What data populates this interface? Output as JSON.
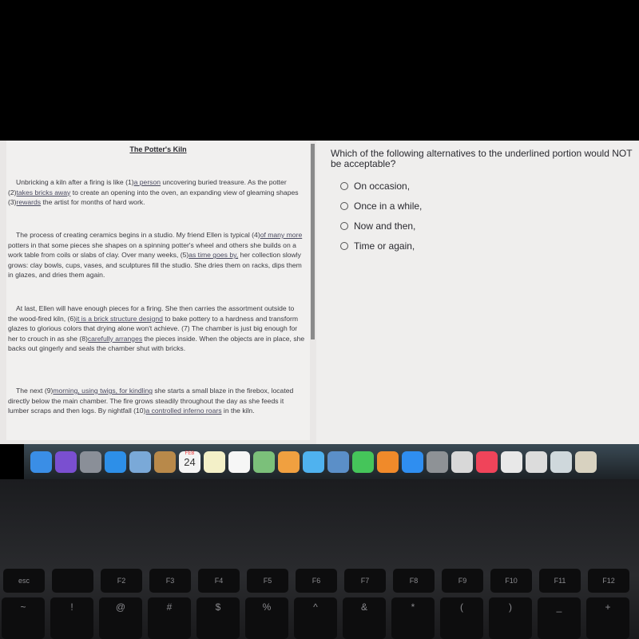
{
  "passage": {
    "title": "The Potter's Kiln",
    "paragraphs": [
      [
        {
          "t": "Unbricking a kiln after a firing is like (1)"
        },
        {
          "t": "a person",
          "u": true
        },
        {
          "t": " uncovering buried treasure. As the potter (2)"
        },
        {
          "t": "takes bricks away",
          "u": true
        },
        {
          "t": " to create an opening into the oven, an expanding view of gleaming shapes (3)"
        },
        {
          "t": "rewards",
          "u": true
        },
        {
          "t": " the artist for months of hard work."
        }
      ],
      [
        {
          "t": "The process of creating ceramics begins in a studio. My friend Ellen is typical (4)"
        },
        {
          "t": "of many more",
          "u": true
        },
        {
          "t": " potters in that some pieces she shapes on a spinning potter's wheel and others she builds on a work table from coils or slabs of clay. Over many weeks, (5)"
        },
        {
          "t": "as time goes by,",
          "u": true
        },
        {
          "t": " her collection slowly grows: clay bowls, cups, vases, and sculptures fill the studio. She dries them on racks, dips them in glazes, and dries them again."
        }
      ],
      [
        {
          "t": "At last, Ellen will have enough pieces for a firing. She then carries the assortment outside to the wood-fired kiln, (6)"
        },
        {
          "t": "it is a brick structure designd",
          "u": true
        },
        {
          "t": " to bake pottery to a hardness and transform glazes to glorious colors that drying alone won't achieve. (7) The chamber is just big enough for her to crouch in as she (8)"
        },
        {
          "t": "carefully arranges",
          "u": true
        },
        {
          "t": " the pieces inside. When the objects are in place, she backs out gingerly and seals the chamber shut with bricks."
        }
      ],
      [
        {
          "t": "The next (9)"
        },
        {
          "t": "morning, using twigs, for kindling",
          "u": true
        },
        {
          "t": " she starts a small blaze in the firebox, located directly below the main chamber. The fire grows steadily throughout the day as she feeds it lumber scraps and then logs. By nightfall (10)"
        },
        {
          "t": "a controlled inferno roars",
          "u": true
        },
        {
          "t": " in the kiln."
        }
      ]
    ]
  },
  "question": {
    "text": "Which of the following alternatives to the underlined portion would NOT be acceptable?",
    "options": [
      "On occasion,",
      "Once in a while,",
      "Now and then,",
      "Time or again,"
    ]
  },
  "dock": {
    "icons": [
      {
        "name": "finder-icon",
        "color": "#3a8ee6"
      },
      {
        "name": "siri-icon",
        "color": "#7a4fd0"
      },
      {
        "name": "launchpad-icon",
        "color": "#8a8f98"
      },
      {
        "name": "safari-icon",
        "color": "#2d8fe8"
      },
      {
        "name": "mail-icon",
        "color": "#7aa9d8"
      },
      {
        "name": "notes-folder-icon",
        "color": "#b8894a"
      },
      {
        "name": "calendar-icon",
        "color": "#f4f4f4"
      },
      {
        "name": "stickies-icon",
        "color": "#f3f0c8"
      },
      {
        "name": "reminders-icon",
        "color": "#f6f6f6"
      },
      {
        "name": "maps-icon",
        "color": "#7bc07a"
      },
      {
        "name": "photos-icon",
        "color": "#f0a040"
      },
      {
        "name": "messages-icon",
        "color": "#4fb2ef"
      },
      {
        "name": "preview-icon",
        "color": "#5b8fc8"
      },
      {
        "name": "facetime-icon",
        "color": "#45c55a"
      },
      {
        "name": "books-icon",
        "color": "#f08a2a"
      },
      {
        "name": "app-store-icon",
        "color": "#2f8ef0"
      },
      {
        "name": "system-preferences-icon",
        "color": "#8e9296"
      },
      {
        "name": "roblox-icon",
        "color": "#d8d8d8"
      },
      {
        "name": "music-icon",
        "color": "#f0445a"
      },
      {
        "name": "document-icon",
        "color": "#e8e8e8"
      },
      {
        "name": "screenshot-icon",
        "color": "#dcdcdc"
      },
      {
        "name": "screenshot-icon",
        "color": "#cfd8dc"
      },
      {
        "name": "screenshot-icon",
        "color": "#d8d2c0"
      }
    ],
    "calendar_day": "24",
    "calendar_month": "FEB"
  },
  "keyboard": {
    "fn_keys": [
      "esc",
      "",
      "F2",
      "F3",
      "F4",
      "F5",
      "F6",
      "F7",
      "F8",
      "F9",
      "F10",
      "F11",
      "F12"
    ],
    "num_keys": [
      "~",
      "!",
      "@",
      "#",
      "$",
      "%",
      "^",
      "&",
      "*",
      "(",
      ")",
      "_",
      "+"
    ]
  }
}
